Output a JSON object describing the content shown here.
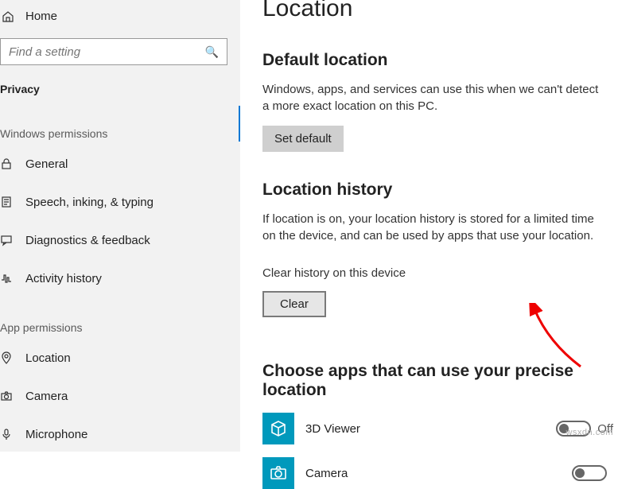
{
  "sidebar": {
    "home": "Home",
    "search_placeholder": "Find a setting",
    "section": "Privacy",
    "groups": [
      {
        "title": "Windows permissions",
        "items": [
          {
            "key": "general",
            "label": "General"
          },
          {
            "key": "speech",
            "label": "Speech, inking, & typing"
          },
          {
            "key": "diagnostics",
            "label": "Diagnostics & feedback"
          },
          {
            "key": "activity",
            "label": "Activity history"
          }
        ]
      },
      {
        "title": "App permissions",
        "items": [
          {
            "key": "location",
            "label": "Location"
          },
          {
            "key": "camera",
            "label": "Camera"
          },
          {
            "key": "microphone",
            "label": "Microphone"
          }
        ]
      }
    ]
  },
  "content": {
    "title": "Location",
    "default_loc": {
      "heading": "Default location",
      "body": "Windows, apps, and services can use this when we can't detect a more exact location on this PC.",
      "button": "Set default"
    },
    "history": {
      "heading": "Location history",
      "body": "If location is on, your location history is stored for a limited time on the device, and can be used by apps that use your location.",
      "sub": "Clear history on this device",
      "button": "Clear"
    },
    "apps": {
      "heading": "Choose apps that can use your precise location",
      "list": [
        {
          "name": "3D Viewer",
          "state": "Off"
        },
        {
          "name": "Camera",
          "state": ""
        }
      ]
    }
  },
  "watermark": "wsxdn.com"
}
